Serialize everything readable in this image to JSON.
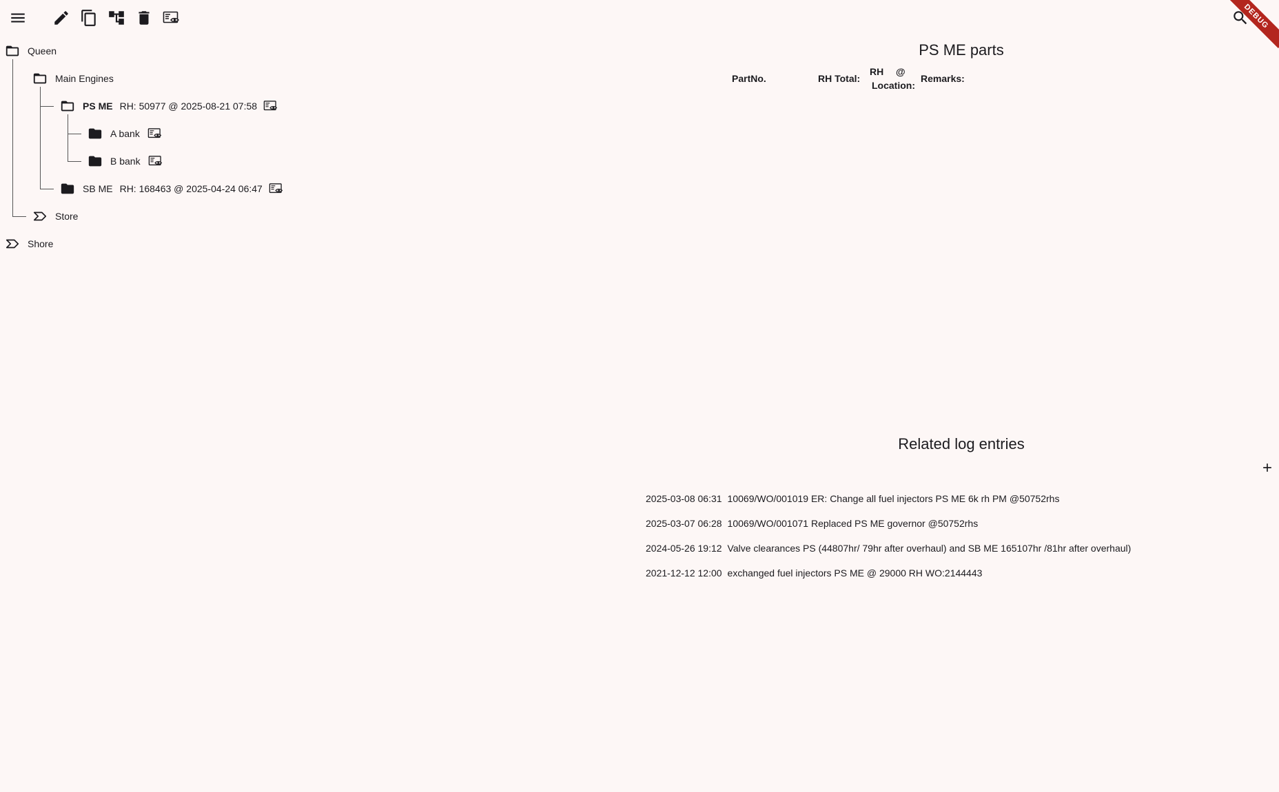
{
  "toolbar": {
    "icons": [
      "menu-icon",
      "edit-icon",
      "copy-icon",
      "tree-icon",
      "delete-icon",
      "view-details-icon",
      "search-icon"
    ]
  },
  "debug_banner": "DEBUG",
  "tree": {
    "root": "Queen",
    "main_engines": "Main Engines",
    "ps_me": {
      "label": "PS ME",
      "rh": "RH: 50977 @ 2025-08-21 07:58"
    },
    "a_bank": "A bank",
    "b_bank": "B bank",
    "sb_me": {
      "label": "SB ME",
      "rh": "RH: 168463 @ 2025-04-24 06:47"
    },
    "store": "Store",
    "shore": "Shore"
  },
  "parts": {
    "title": "PS ME parts",
    "headers": {
      "part_no": "PartNo.",
      "rh_total": "RH Total:",
      "rh": "RH",
      "at": "@",
      "location": "Location:",
      "remarks": "Remarks:"
    }
  },
  "log": {
    "title": "Related log entries",
    "entries": [
      {
        "date": "2025-03-08 06:31",
        "text": "10069/WO/001019 ER: Change all fuel injectors PS ME 6k rh PM @50752rhs"
      },
      {
        "date": "2025-03-07 06:28",
        "text": "10069/WO/001071 Replaced PS ME governor @50752rhs"
      },
      {
        "date": "2024-05-26 19:12",
        "text": "Valve clearances PS (44807hr/ 79hr after overhaul) and SB ME 165107hr /81hr after overhaul)"
      },
      {
        "date": "2021-12-12 12:00",
        "text": "exchanged fuel injectors PS ME @ 29000 RH WO:2144443"
      }
    ]
  },
  "colors": {
    "background": "#fdf7f6",
    "text": "#1c1b1f",
    "debug": "#b3261e"
  }
}
